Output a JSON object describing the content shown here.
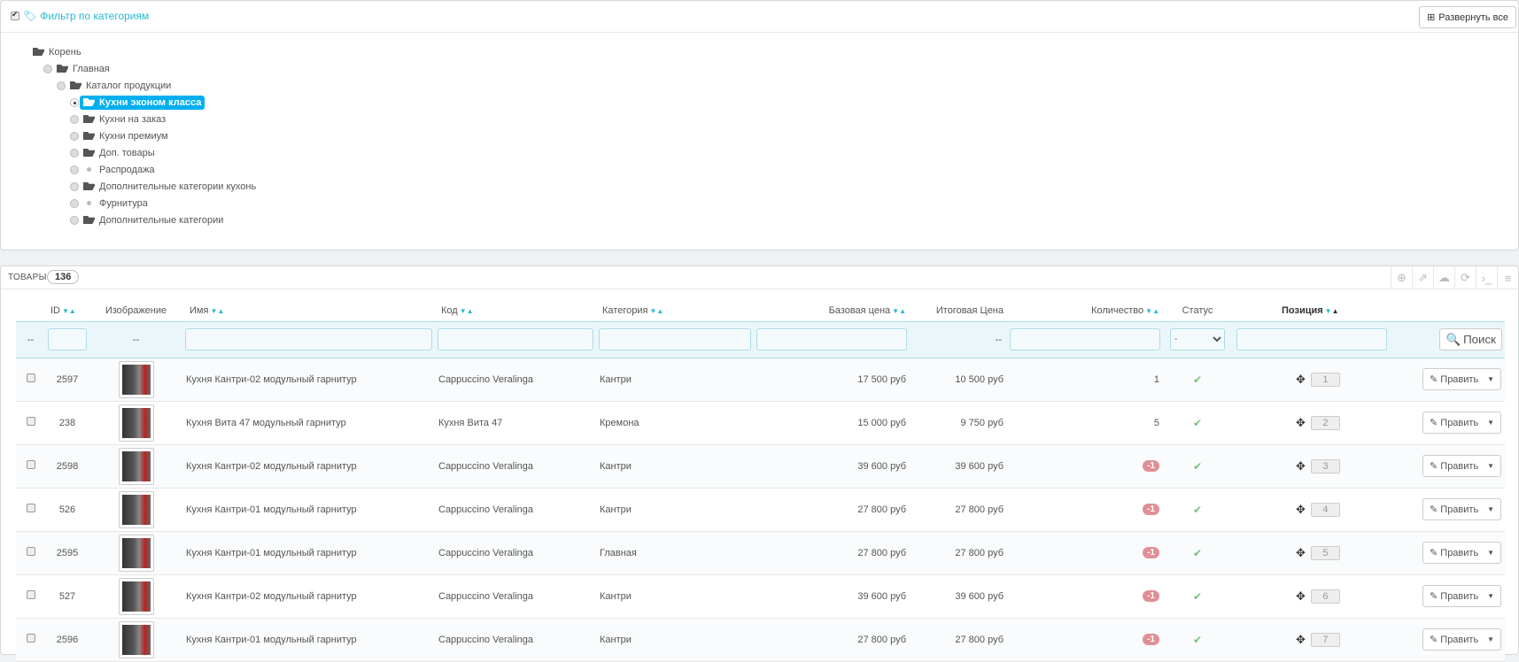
{
  "category_filter": {
    "title": "Фильтр по категориям",
    "expand_all": "Развернуть все",
    "tree": [
      {
        "label": "Корень",
        "level": 0,
        "type": "folder",
        "radio": false,
        "selected": false
      },
      {
        "label": "Главная",
        "level": 1,
        "type": "folder",
        "radio": true,
        "selected": false
      },
      {
        "label": "Каталог продукции",
        "level": 2,
        "type": "folder",
        "radio": true,
        "selected": false
      },
      {
        "label": "Кухни эконом класса",
        "level": 3,
        "type": "folder",
        "radio": true,
        "selected": true
      },
      {
        "label": "Кухни на заказ",
        "level": 3,
        "type": "folder",
        "radio": true,
        "selected": false
      },
      {
        "label": "Кухни премиум",
        "level": 3,
        "type": "folder",
        "radio": true,
        "selected": false
      },
      {
        "label": "Доп. товары",
        "level": 3,
        "type": "folder",
        "radio": true,
        "selected": false
      },
      {
        "label": "Распродажа",
        "level": 3,
        "type": "leaf",
        "radio": true,
        "selected": false
      },
      {
        "label": "Дополнительные категории кухонь",
        "level": 3,
        "type": "folder",
        "radio": true,
        "selected": false
      },
      {
        "label": "Фурнитура",
        "level": 3,
        "type": "leaf",
        "radio": true,
        "selected": false
      },
      {
        "label": "Дополнительные категории",
        "level": 3,
        "type": "folder",
        "radio": true,
        "selected": false
      }
    ]
  },
  "products": {
    "title": "ТОВАРЫ",
    "count": "136",
    "columns": {
      "id": "ID",
      "image": "Изображение",
      "name": "Имя",
      "code": "Код",
      "category": "Категория",
      "base_price": "Базовая цена",
      "final_price": "Итоговая Цена",
      "quantity": "Количество",
      "status": "Статус",
      "position": "Позиция"
    },
    "filter": {
      "dash": "--",
      "status_value": "-",
      "search": "Поиск"
    },
    "edit_label": "Править",
    "rows": [
      {
        "id": "2597",
        "name": "Кухня Кантри-02 модульный гарнитур",
        "code": "Cappuccino Veralinga",
        "category": "Кантри",
        "base_price": "17 500 руб",
        "final_price": "10 500 руб",
        "quantity": "1",
        "negative": false,
        "position": "1"
      },
      {
        "id": "238",
        "name": "Кухня Вита 47 модульный гарнитур",
        "code": "Кухня Вита 47",
        "category": "Кремона",
        "base_price": "15 000 руб",
        "final_price": "9 750 руб",
        "quantity": "5",
        "negative": false,
        "position": "2"
      },
      {
        "id": "2598",
        "name": "Кухня Кантри-02 модульный гарнитур",
        "code": "Cappuccino Veralinga",
        "category": "Кантри",
        "base_price": "39 600 руб",
        "final_price": "39 600 руб",
        "quantity": "-1",
        "negative": true,
        "position": "3"
      },
      {
        "id": "526",
        "name": "Кухня Кантри-01 модульный гарнитур",
        "code": "Cappuccino Veralinga",
        "category": "Кантри",
        "base_price": "27 800 руб",
        "final_price": "27 800 руб",
        "quantity": "-1",
        "negative": true,
        "position": "4"
      },
      {
        "id": "2595",
        "name": "Кухня Кантри-01 модульный гарнитур",
        "code": "Cappuccino Veralinga",
        "category": "Главная",
        "base_price": "27 800 руб",
        "final_price": "27 800 руб",
        "quantity": "-1",
        "negative": true,
        "position": "5"
      },
      {
        "id": "527",
        "name": "Кухня Кантри-02 модульный гарнитур",
        "code": "Cappuccino Veralinga",
        "category": "Кантри",
        "base_price": "39 600 руб",
        "final_price": "39 600 руб",
        "quantity": "-1",
        "negative": true,
        "position": "6"
      },
      {
        "id": "2596",
        "name": "Кухня Кантри-01 модульный гарнитур",
        "code": "Cappuccino Veralinga",
        "category": "Кантри",
        "base_price": "27 800 руб",
        "final_price": "27 800 руб",
        "quantity": "-1",
        "negative": true,
        "position": "7"
      }
    ]
  },
  "colors": {
    "accent": "#25b9d7",
    "selected": "#00aff0",
    "negative": "#e08f95",
    "ok": "#72c279"
  }
}
